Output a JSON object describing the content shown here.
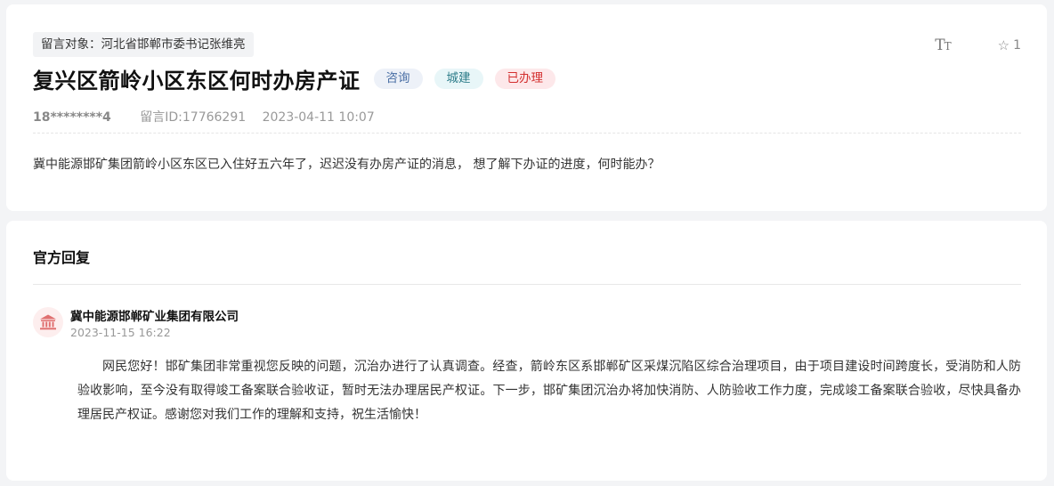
{
  "message": {
    "target_label": "留言对象：河北省邯郸市委书记张维亮",
    "font_size_label": "T",
    "font_size_label_small": "T",
    "favorite_count": "1",
    "title": "复兴区箭岭小区东区何时办房产证",
    "badges": {
      "type": "咨询",
      "category": "城建",
      "status": "已办理"
    },
    "user": "18********4",
    "message_id": "留言ID:17766291",
    "datetime": "2023-04-11 10:07",
    "content": "冀中能源邯矿集团箭岭小区东区已入住好五六年了，迟迟没有办房产证的消息， 想了解下办证的进度，何时能办？"
  },
  "reply": {
    "section_title": "官方回复",
    "org_name": "冀中能源邯郸矿业集团有限公司",
    "datetime": "2023-11-15 16:22",
    "content": "网民您好！邯矿集团非常重视您反映的问题，沉治办进行了认真调查。经查，箭岭东区系邯郸矿区采煤沉陷区综合治理项目，由于项目建设时间跨度长，受消防和人防验收影响，至今没有取得竣工备案联合验收证，暂时无法办理居民产权证。下一步，邯矿集团沉治办将加快消防、人防验收工作力度，完成竣工备案联合验收，尽快具备办理居民产权证。感谢您对我们工作的理解和支持，祝生活愉快！"
  },
  "icons": {
    "font_size": "text-size-icon",
    "favorite": "star-outline-icon",
    "org": "government-building-icon"
  },
  "colors": {
    "page_bg": "#f3f4f6",
    "badge_type_text": "#4a6fa5",
    "badge_category_text": "#2e7d8a",
    "badge_status_text": "#d32f2f",
    "org_icon": "#e07070"
  }
}
